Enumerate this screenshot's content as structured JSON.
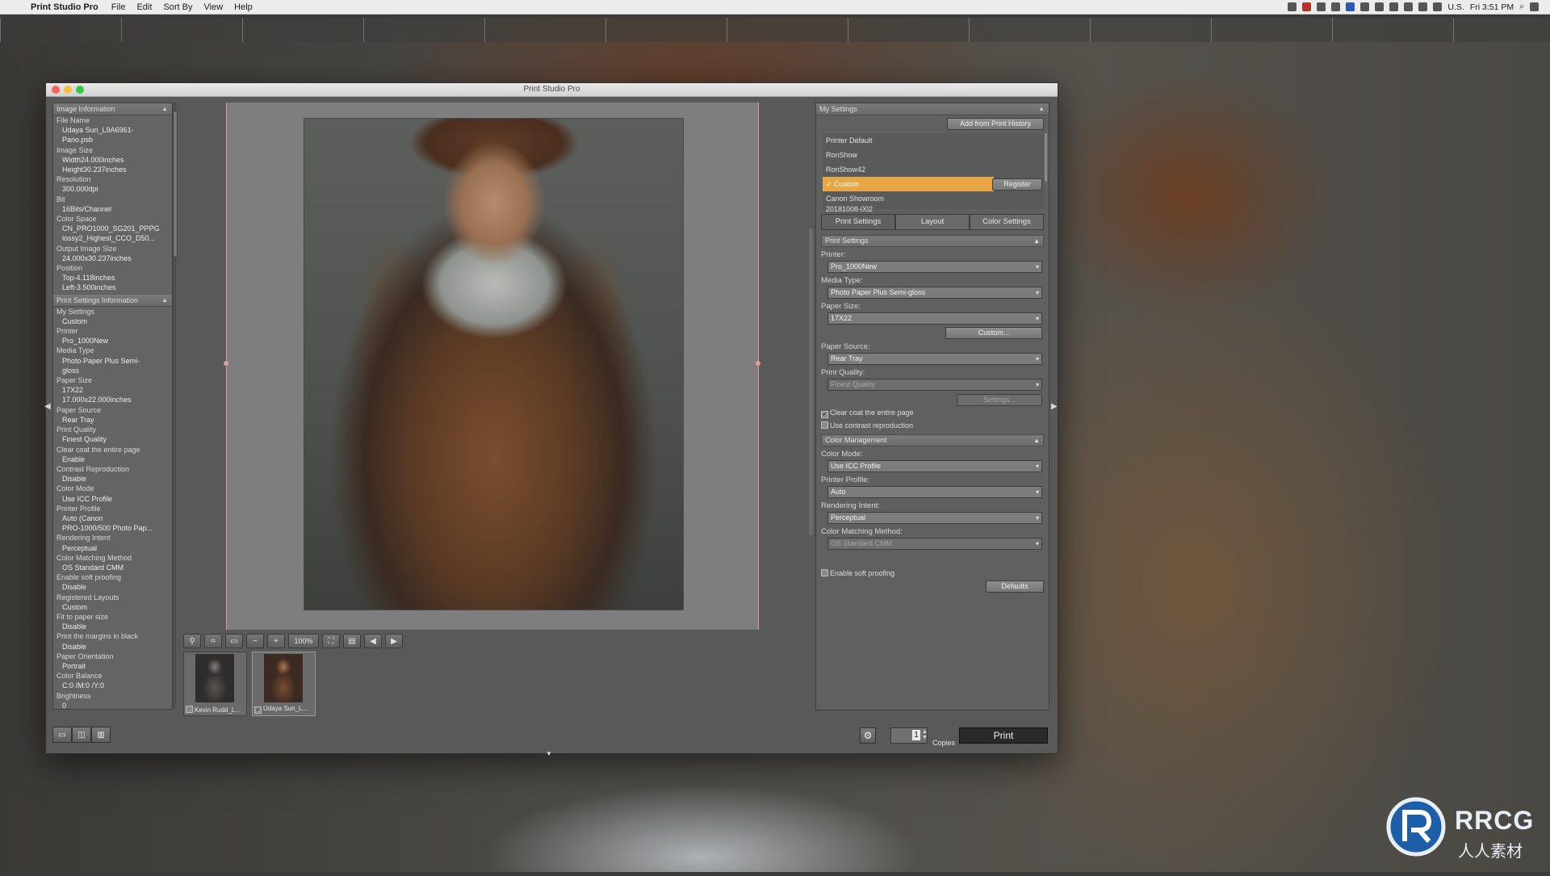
{
  "menubar": {
    "app_name": "Print Studio Pro",
    "items": [
      "File",
      "Edit",
      "Sort By",
      "View",
      "Help"
    ],
    "input_source": "U.S.",
    "clock": "Fri 3:51 PM"
  },
  "window": {
    "title": "Print Studio Pro"
  },
  "image_info": {
    "header": "Image Information",
    "lines": [
      {
        "t": "File Name",
        "v": false
      },
      {
        "t": "Udaya Sun_L9A6961-",
        "v": true
      },
      {
        "t": "Pano.psb",
        "v": true
      },
      {
        "t": "Image Size",
        "v": false
      },
      {
        "t": "Width24.000inches",
        "v": true
      },
      {
        "t": "Height30.237inches",
        "v": true
      },
      {
        "t": "Resolution",
        "v": false
      },
      {
        "t": "300.000dpi",
        "v": true
      },
      {
        "t": "Bit",
        "v": false
      },
      {
        "t": "16Bits/Channel",
        "v": true
      },
      {
        "t": "Color Space",
        "v": false
      },
      {
        "t": "CN_PRO1000_SG201_PPPG",
        "v": true
      },
      {
        "t": "lossy2_Highest_CCO_D50...",
        "v": true
      },
      {
        "t": "Output Image Size",
        "v": false
      },
      {
        "t": "24.000x30.237inches",
        "v": true
      },
      {
        "t": "Position",
        "v": false
      },
      {
        "t": "Top-4.118inches",
        "v": true
      },
      {
        "t": "Left-3.500inches",
        "v": true
      }
    ]
  },
  "print_settings_info": {
    "header": "Print Settings Information",
    "lines": [
      {
        "t": "My Settings",
        "v": false
      },
      {
        "t": "Custom",
        "v": true
      },
      {
        "t": "Printer",
        "v": false
      },
      {
        "t": "Pro_1000New",
        "v": true
      },
      {
        "t": "Media Type",
        "v": false
      },
      {
        "t": "Photo Paper Plus Semi-",
        "v": true
      },
      {
        "t": "gloss",
        "v": true
      },
      {
        "t": "Paper Size",
        "v": false
      },
      {
        "t": "17X22",
        "v": true
      },
      {
        "t": "17.000x22.000inches",
        "v": true
      },
      {
        "t": "Paper Source",
        "v": false
      },
      {
        "t": "Rear Tray",
        "v": true
      },
      {
        "t": "Print Quality",
        "v": false
      },
      {
        "t": "Finest Quality",
        "v": true
      },
      {
        "t": "Clear coat the entire page",
        "v": false
      },
      {
        "t": "Enable",
        "v": true
      },
      {
        "t": "Contrast Reproduction",
        "v": false
      },
      {
        "t": "Disable",
        "v": true
      },
      {
        "t": "Color Mode",
        "v": false
      },
      {
        "t": "Use ICC Profile",
        "v": true
      },
      {
        "t": "Printer Profile",
        "v": false
      },
      {
        "t": "Auto (Canon",
        "v": true
      },
      {
        "t": "PRO-1000/500 Photo Pap...",
        "v": true
      },
      {
        "t": "Rendering Intent",
        "v": false
      },
      {
        "t": "Perceptual",
        "v": true
      },
      {
        "t": "Color Matching Method",
        "v": false
      },
      {
        "t": "OS Standard CMM",
        "v": true
      },
      {
        "t": "Enable soft proofing",
        "v": false
      },
      {
        "t": "Disable",
        "v": true
      },
      {
        "t": "Registered Layouts",
        "v": false
      },
      {
        "t": "Custom",
        "v": true
      },
      {
        "t": "Fit to paper size",
        "v": false
      },
      {
        "t": "Disable",
        "v": true
      },
      {
        "t": "Print the margins in black",
        "v": false
      },
      {
        "t": "Disable",
        "v": true
      },
      {
        "t": "Paper Orientation",
        "v": false
      },
      {
        "t": "Portrait",
        "v": true
      },
      {
        "t": "Color Balance",
        "v": false
      },
      {
        "t": "C:0 /M:0 /Y:0",
        "v": true
      },
      {
        "t": "Brightness",
        "v": false
      },
      {
        "t": "0",
        "v": true
      }
    ]
  },
  "toolbar": {
    "zoom": "100%"
  },
  "thumbnails": [
    {
      "caption": "Kevin Rudd_L...",
      "checked": false
    },
    {
      "caption": "Udaya Sun_L...",
      "checked": true
    }
  ],
  "my_settings": {
    "header": "My Settings",
    "add_button": "Add from Print History",
    "register_button": "Register",
    "items": [
      "Printer Default",
      "RonShow",
      "RonShow42",
      "Custom",
      "Canon Showroom",
      "20181008-002"
    ],
    "selected": "Custom"
  },
  "tabs": [
    "Print Settings",
    "Layout",
    "Color Settings"
  ],
  "print_settings": {
    "header": "Print Settings",
    "printer_label": "Printer:",
    "printer": "Pro_1000New",
    "media_label": "Media Type:",
    "media": "Photo Paper Plus Semi-gloss",
    "paper_size_label": "Paper Size:",
    "paper_size": "17X22",
    "custom_button": "Custom...",
    "paper_source_label": "Paper Source:",
    "paper_source": "Rear Tray",
    "quality_label": "Print Quality:",
    "quality": "Finest Quality",
    "settings_button": "Settings...",
    "clear_coat": "Clear coat the entire page",
    "contrast": "Use contrast reproduction"
  },
  "color_management": {
    "header": "Color Management",
    "mode_label": "Color Mode:",
    "mode": "Use ICC Profile",
    "profile_label": "Printer Profile:",
    "profile": "Auto",
    "intent_label": "Rendering Intent:",
    "intent": "Perceptual",
    "method_label": "Color Matching Method:",
    "method": "OS Standard CMM",
    "soft_proof": "Enable soft proofing",
    "defaults_button": "Defaults"
  },
  "bottom": {
    "copies_label": "Copies",
    "copies": "1",
    "print_button": "Print"
  },
  "watermark": {
    "brand": "RRCG",
    "sub": "人人素材"
  },
  "colors": {
    "selection": "#e8a645",
    "guide": "#e09aa0"
  }
}
